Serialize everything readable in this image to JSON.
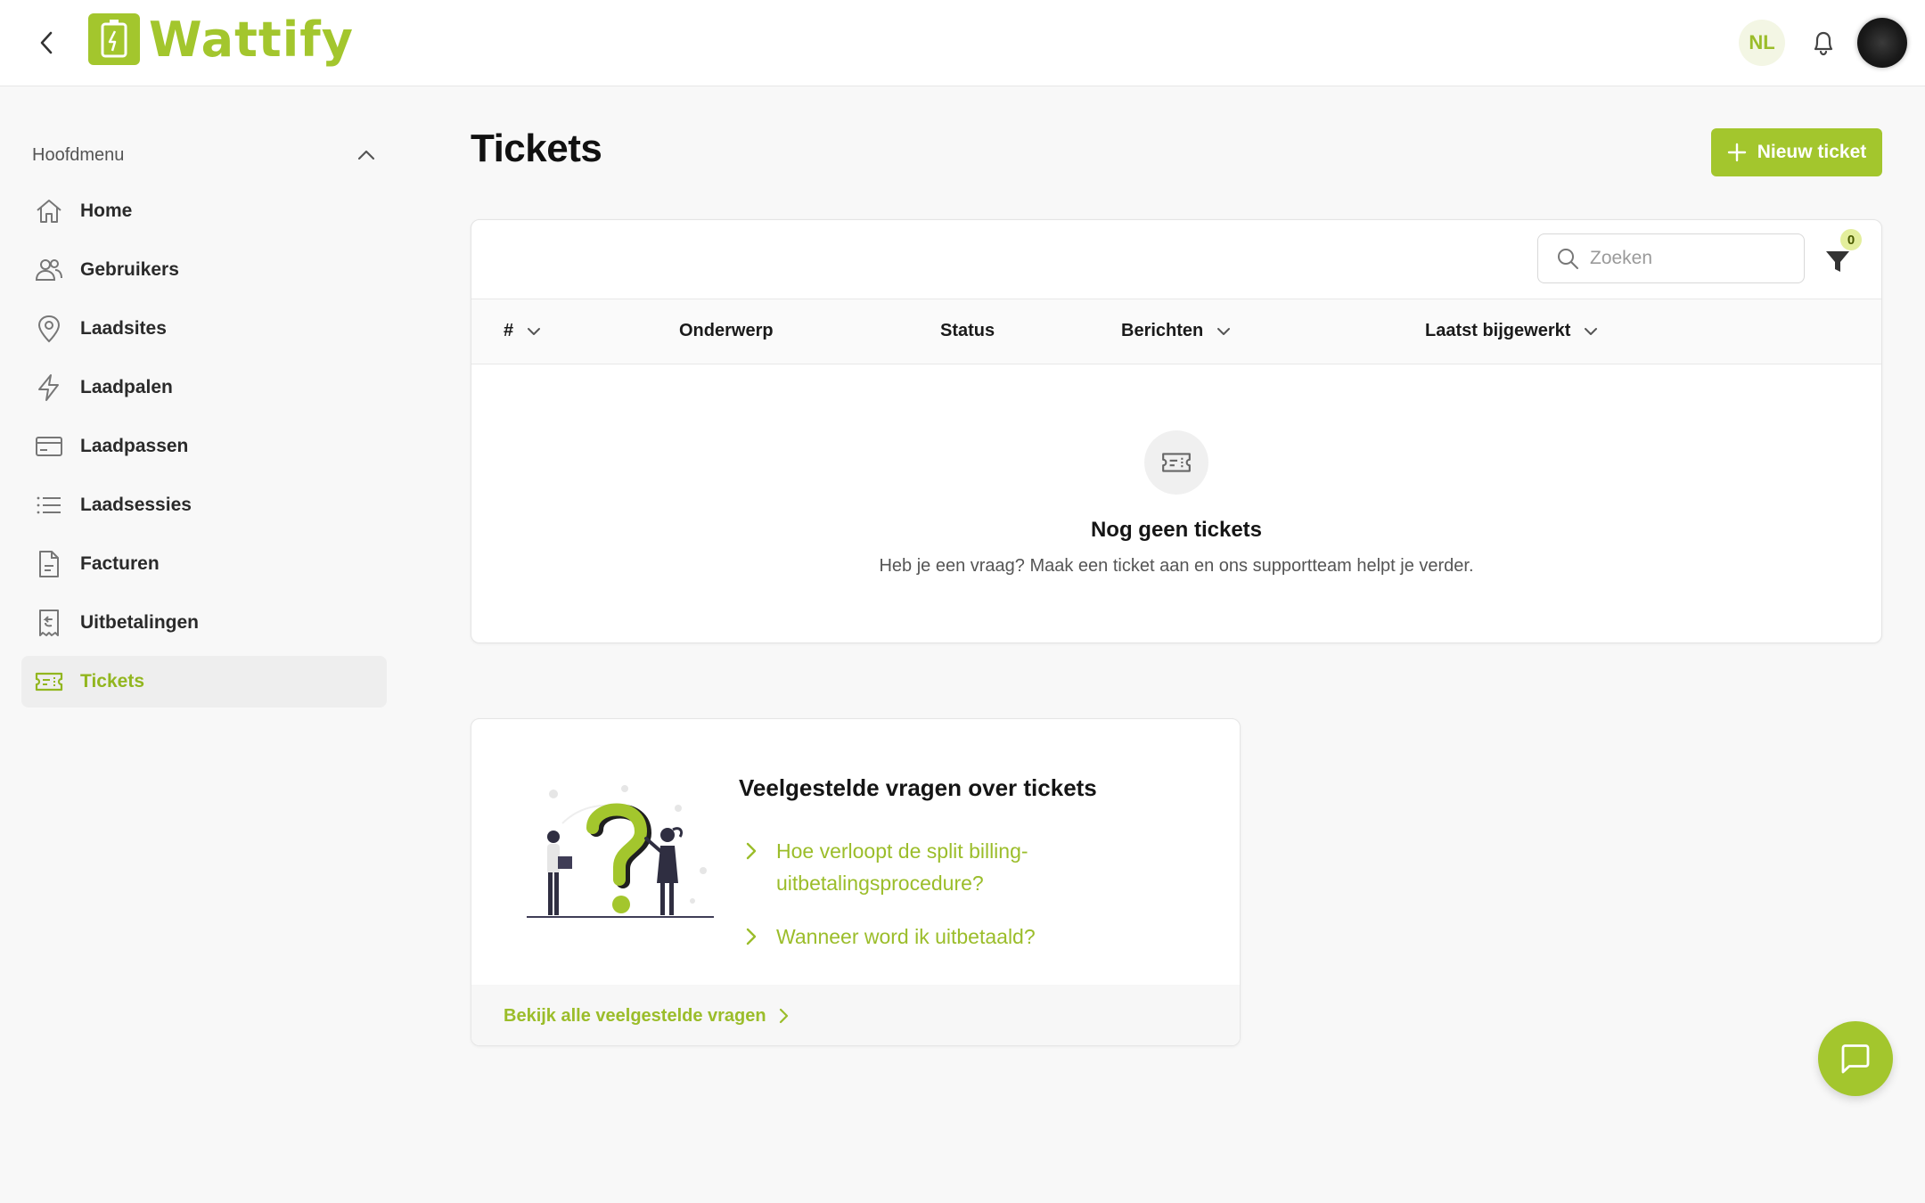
{
  "header": {
    "brand": "Wattify",
    "language": "NL"
  },
  "sidebar": {
    "section_title": "Hoofdmenu",
    "items": [
      {
        "label": "Home",
        "icon": "home-icon"
      },
      {
        "label": "Gebruikers",
        "icon": "users-icon"
      },
      {
        "label": "Laadsites",
        "icon": "location-pin-icon"
      },
      {
        "label": "Laadpalen",
        "icon": "lightning-icon"
      },
      {
        "label": "Laadpassen",
        "icon": "card-icon"
      },
      {
        "label": "Laadsessies",
        "icon": "list-icon"
      },
      {
        "label": "Facturen",
        "icon": "document-icon"
      },
      {
        "label": "Uitbetalingen",
        "icon": "receipt-icon"
      },
      {
        "label": "Tickets",
        "icon": "ticket-icon",
        "active": true
      }
    ]
  },
  "main": {
    "title": "Tickets",
    "new_button": "Nieuw ticket",
    "search_placeholder": "Zoeken",
    "filter_count": "0",
    "columns": [
      "#",
      "Onderwerp",
      "Status",
      "Berichten",
      "Laatst bijgewerkt"
    ],
    "empty_title": "Nog geen tickets",
    "empty_subtitle": "Heb je een vraag? Maak een ticket aan en ons supportteam helpt je verder."
  },
  "faq": {
    "title": "Veelgestelde vragen over tickets",
    "questions": [
      "Hoe verloopt de split billing-uitbetalingsprocedure?",
      "Wanneer word ik uitbetaald?"
    ],
    "footer_link": "Bekijk alle veelgestelde vragen"
  },
  "colors": {
    "accent": "#a3c62d",
    "accent_text": "#9bbd2a",
    "background": "#f8f8f8"
  }
}
